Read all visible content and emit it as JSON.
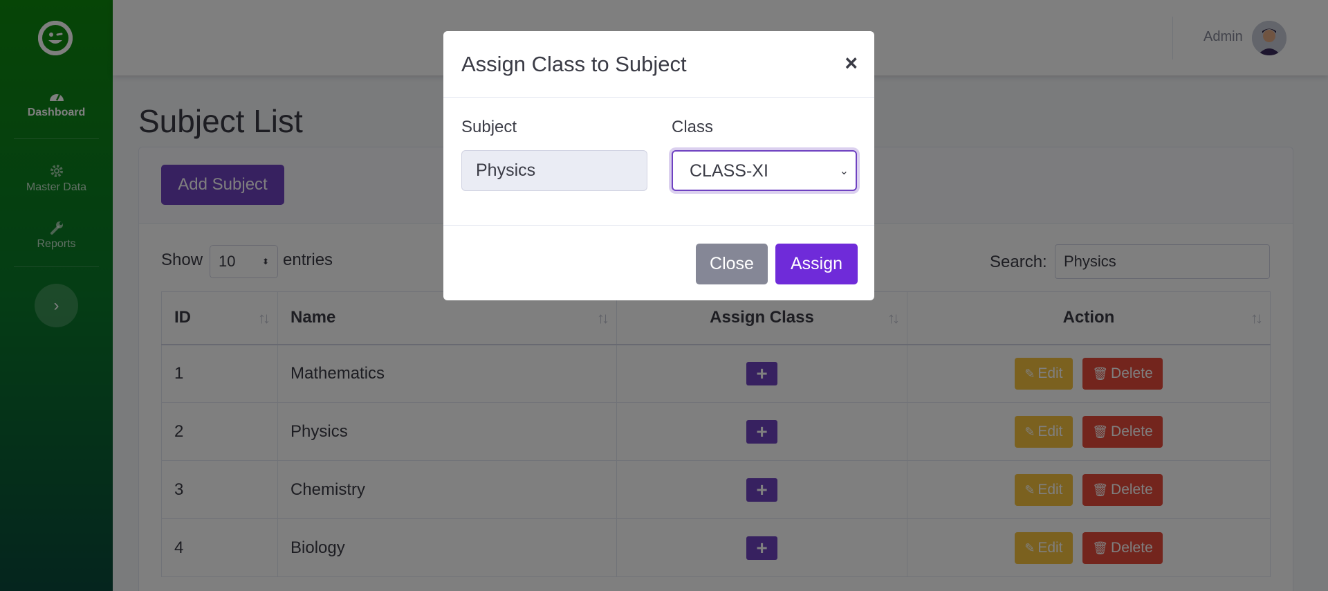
{
  "sidebar": {
    "items": [
      {
        "label": "Dashboard",
        "icon": "tachometer-icon",
        "active": true
      },
      {
        "label": "Master Data",
        "icon": "gear-icon"
      },
      {
        "label": "Reports",
        "icon": "wrench-icon"
      }
    ]
  },
  "topbar": {
    "user_name": "Admin"
  },
  "page": {
    "title": "Subject List",
    "add_button": "Add Subject",
    "show_label": "Show",
    "entries_value": "10",
    "entries_label": "entries",
    "search_label": "Search:",
    "search_value": "Physics"
  },
  "table": {
    "columns": [
      "ID",
      "Name",
      "Assign Class",
      "Action"
    ],
    "rows": [
      {
        "id": "1",
        "name": "Mathematics"
      },
      {
        "id": "2",
        "name": "Physics"
      },
      {
        "id": "3",
        "name": "Chemistry"
      },
      {
        "id": "4",
        "name": "Biology"
      }
    ],
    "plus_label": "+",
    "edit_label": "Edit",
    "delete_label": "Delete"
  },
  "modal": {
    "title": "Assign Class to Subject",
    "close_x": "×",
    "subject_label": "Subject",
    "subject_value": "Physics",
    "class_label": "Class",
    "class_value": "CLASS-XI",
    "close_button": "Close",
    "assign_button": "Assign"
  },
  "colors": {
    "primary": "#6f42c1",
    "warning": "#f6c23e",
    "danger": "#e74a3b",
    "sidebar": "#0d8a0d"
  }
}
